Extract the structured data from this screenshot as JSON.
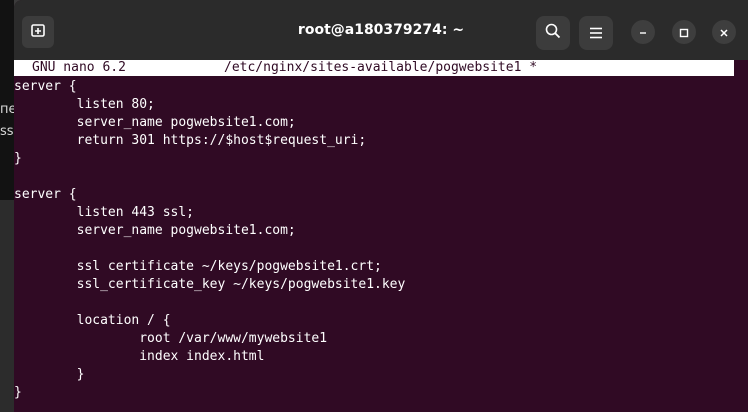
{
  "background_window": {
    "text_lines": [
      "пе",
      "ss"
    ]
  },
  "window": {
    "title": "root@a180379274: ~"
  },
  "titlebar": {
    "new_tab_icon": "new-tab-icon",
    "search_icon": "search-icon",
    "menu_icon": "hamburger-menu-icon",
    "minimize_icon": "minimize-icon",
    "maximize_icon": "maximize-icon",
    "close_icon": "close-icon"
  },
  "nano": {
    "version": "GNU nano 6.2",
    "file_path": "/etc/nginx/sites-available/pogwebsite1 *"
  },
  "editor": {
    "lines": [
      "server {",
      "        listen 80;",
      "        server_name pogwebsite1.com;",
      "        return 301 https://$host$request_uri;",
      "}",
      "",
      "server {",
      "        listen 443 ssl;",
      "        server_name pogwebsite1.com;",
      "",
      "        ssl certificate ~/keys/pogwebsite1.crt;",
      "        ssl_certificate_key ~/keys/pogwebsite1.key",
      "",
      "        location / {",
      "                root /var/www/mywebsite1",
      "                index index.html",
      "        }",
      "}"
    ]
  },
  "colors": {
    "terminal_bg": "#300a24",
    "titlebar_bg": "#2b2b2b",
    "text": "#ffffff",
    "header_bg": "#ffffff"
  }
}
